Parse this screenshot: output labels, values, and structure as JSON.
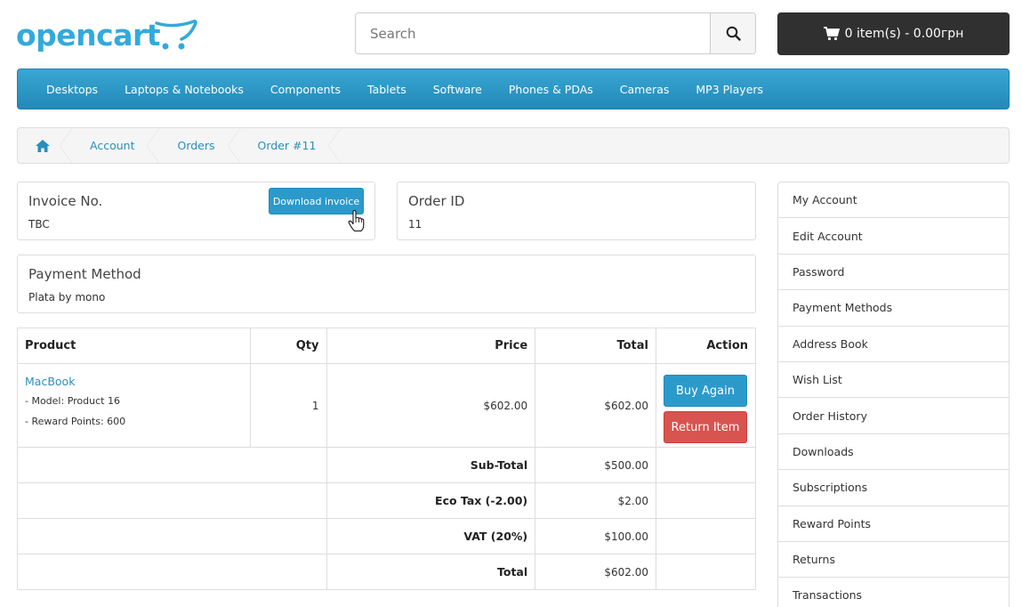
{
  "header": {
    "logo_text": "opencart",
    "search_placeholder": "Search",
    "cart_label": "0 item(s) - 0.00грн"
  },
  "menu": [
    "Desktops",
    "Laptops & Notebooks",
    "Components",
    "Tablets",
    "Software",
    "Phones & PDAs",
    "Cameras",
    "MP3 Players"
  ],
  "breadcrumb": [
    "Account",
    "Orders",
    "Order #11"
  ],
  "invoice": {
    "title": "Invoice No.",
    "value": "TBC",
    "button": "Download invoice"
  },
  "order": {
    "title": "Order ID",
    "value": "11"
  },
  "payment": {
    "title": "Payment Method",
    "value": "Plata by mono"
  },
  "table": {
    "headers": {
      "product": "Product",
      "qty": "Qty",
      "price": "Price",
      "total": "Total",
      "action": "Action"
    },
    "product": {
      "name": "MacBook",
      "model": "- Model: Product 16",
      "points": "- Reward Points: 600",
      "qty": "1",
      "price": "$602.00",
      "total": "$602.00",
      "buy_again": "Buy Again",
      "return_item": "Return Item"
    },
    "totals": [
      {
        "label": "Sub-Total",
        "value": "$500.00"
      },
      {
        "label": "Eco Tax (-2.00)",
        "value": "$2.00"
      },
      {
        "label": "VAT (20%)",
        "value": "$100.00"
      },
      {
        "label": "Total",
        "value": "$602.00"
      }
    ]
  },
  "sidebar": [
    "My Account",
    "Edit Account",
    "Password",
    "Payment Methods",
    "Address Book",
    "Wish List",
    "Order History",
    "Downloads",
    "Subscriptions",
    "Reward Points",
    "Returns",
    "Transactions"
  ],
  "colors": {
    "accent": "#2b9acb",
    "danger": "#d9534f",
    "dark": "#303030",
    "logo": "#33a9dc"
  },
  "icons": [
    "shopping-cart-icon",
    "search-icon",
    "home-icon",
    "hand-pointer-icon"
  ]
}
